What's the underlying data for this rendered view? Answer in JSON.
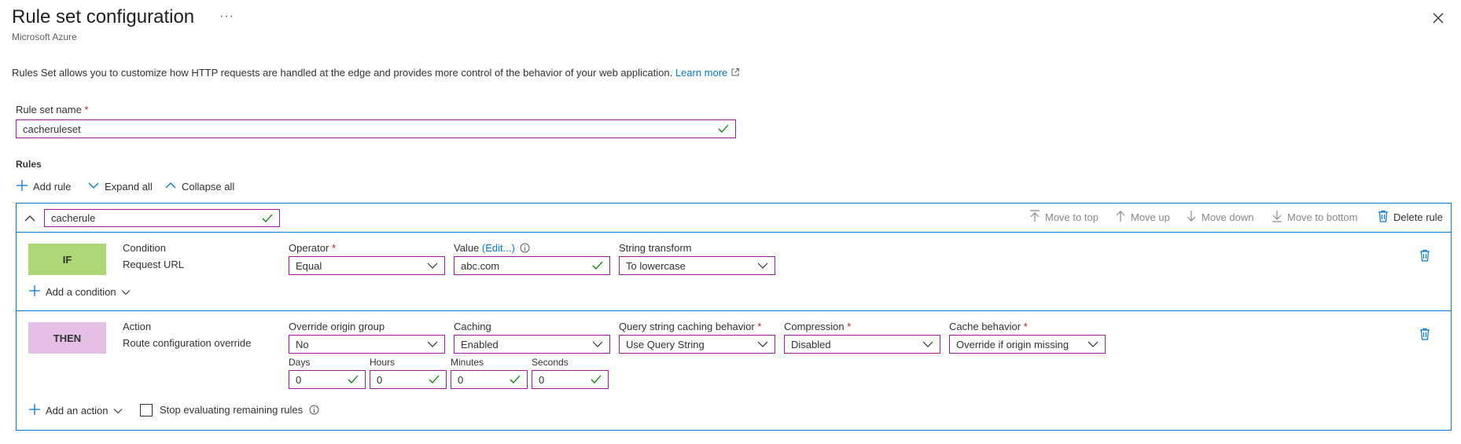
{
  "header": {
    "title": "Rule set configuration",
    "more_label": "···",
    "subtitle": "Microsoft Azure",
    "close_icon": "close-icon"
  },
  "description": {
    "text": "Rules Set allows you to customize how HTTP requests are handled at the edge and provides more control of the behavior of your web application.",
    "learn_more": "Learn more"
  },
  "rule_set_name": {
    "label": "Rule set name",
    "required_mark": "*",
    "value": "cacheruleset"
  },
  "rules": {
    "heading": "Rules",
    "toolbar": {
      "add_rule": "Add rule",
      "expand_all": "Expand all",
      "collapse_all": "Collapse all"
    }
  },
  "rule": {
    "name": "cacherule",
    "actions": {
      "move_to_top": "Move to top",
      "move_up": "Move up",
      "move_down": "Move down",
      "move_to_bottom": "Move to bottom",
      "delete_rule": "Delete rule"
    },
    "condition": {
      "badge": "IF",
      "title": "Condition",
      "type": "Request URL",
      "operator_label": "Operator",
      "operator_value": "Equal",
      "value_label": "Value",
      "value_edit": "(Edit...)",
      "value_value": "abc.com",
      "string_transform_label": "String transform",
      "string_transform_value": "To lowercase",
      "add_condition": "Add a condition"
    },
    "action": {
      "badge": "THEN",
      "title": "Action",
      "type": "Route configuration override",
      "override_origin_label": "Override origin group",
      "override_origin_value": "No",
      "caching_label": "Caching",
      "caching_value": "Enabled",
      "query_string_label": "Query string caching behavior",
      "query_string_value": "Use Query String",
      "compression_label": "Compression",
      "compression_value": "Disabled",
      "cache_behavior_label": "Cache behavior",
      "cache_behavior_value": "Override if origin missing",
      "days_label": "Days",
      "days_value": "0",
      "hours_label": "Hours",
      "hours_value": "0",
      "minutes_label": "Minutes",
      "minutes_value": "0",
      "seconds_label": "Seconds",
      "seconds_value": "0",
      "add_action": "Add an action",
      "stop_evaluating": "Stop evaluating remaining rules"
    }
  },
  "colors": {
    "accent": "#0078d4",
    "field_border": "#9b1c9b",
    "valid_check": "#107c10",
    "if_badge": "#acd775",
    "then_badge": "#e4bfe8"
  }
}
